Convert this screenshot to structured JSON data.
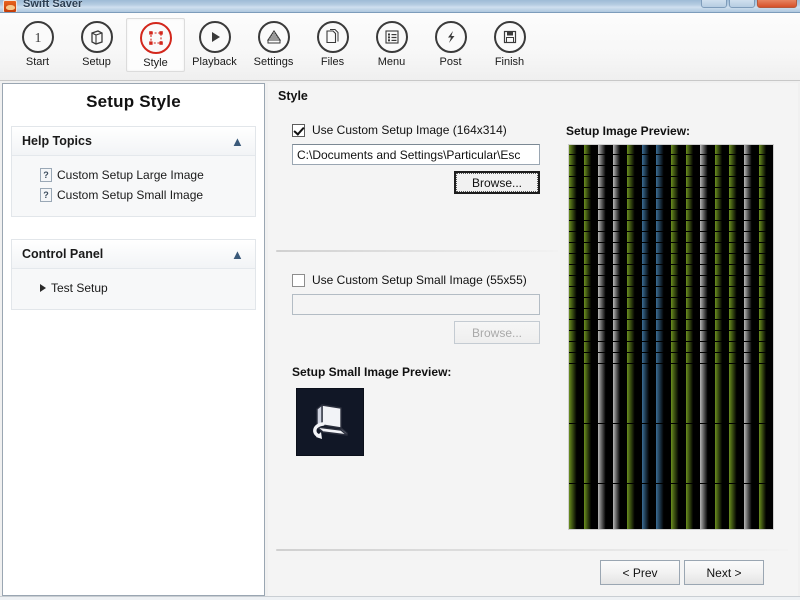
{
  "window": {
    "title": "Swift Saver",
    "icon": "app-icon",
    "controls": [
      {
        "name": "minimize",
        "label": ""
      },
      {
        "name": "maximize",
        "label": ""
      },
      {
        "name": "close",
        "label": ""
      }
    ]
  },
  "toolbar": {
    "items": [
      {
        "label": "Start",
        "icon": "circle-number-one-icon",
        "active": false
      },
      {
        "label": "Setup",
        "icon": "box-icon",
        "active": false
      },
      {
        "label": "Style",
        "icon": "crop-frame-icon",
        "active": true
      },
      {
        "label": "Playback",
        "icon": "play-icon",
        "active": false
      },
      {
        "label": "Settings",
        "icon": "grid-settings-icon",
        "active": false
      },
      {
        "label": "Files",
        "icon": "documents-icon",
        "active": false
      },
      {
        "label": "Menu",
        "icon": "list-icon",
        "active": false
      },
      {
        "label": "Post",
        "icon": "lightning-icon",
        "active": false
      },
      {
        "label": "Finish",
        "icon": "save-disk-icon",
        "active": false
      }
    ]
  },
  "sidebar": {
    "title": "Setup Style",
    "groups": [
      {
        "header": "Help Topics",
        "collapse_icon": "chevron-double-up-icon",
        "items": [
          {
            "label": "Custom Setup Large Image",
            "icon": "help-page-icon"
          },
          {
            "label": "Custom Setup Small Image",
            "icon": "help-page-icon"
          }
        ]
      },
      {
        "header": "Control Panel",
        "collapse_icon": "chevron-double-up-icon",
        "items": [
          {
            "label": "Test Setup",
            "icon": "play-triangle-icon"
          }
        ]
      }
    ]
  },
  "main": {
    "title": "Style",
    "large_image": {
      "checkbox_label": "Use Custom Setup Image (164x314)",
      "checked": true,
      "path_value": "C:\\Documents and Settings\\Particular\\Esc",
      "path_placeholder": "",
      "browse_label": "Browse...",
      "browse_enabled": true
    },
    "small_image": {
      "checkbox_label": "Use Custom Setup Small Image (55x55)",
      "checked": false,
      "path_value": "",
      "path_placeholder": "",
      "browse_label": "Browse...",
      "browse_enabled": false,
      "preview_label": "Setup Small Image Preview:",
      "preview_icon": "computer-monitor-icon"
    },
    "preview": {
      "label": "Setup Image Preview:",
      "description": "Vertical striped gradient pattern in green, blue and grey on black"
    },
    "nav": {
      "prev_label": "< Prev",
      "next_label": "Next >"
    }
  },
  "colors": {
    "accent_red": "#d3271c",
    "title_blue": "#9dbbd6",
    "preview_green": "#6b8f1f",
    "preview_blue": "#3b6d96",
    "preview_grey": "#b8b8b8",
    "preview_bg": "#000000",
    "small_preview_bg": "#111726"
  }
}
